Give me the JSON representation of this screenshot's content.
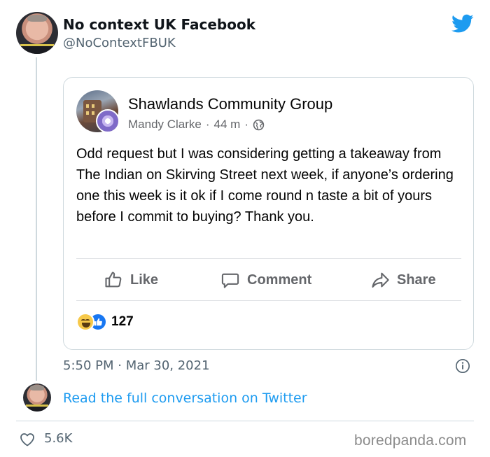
{
  "tweet": {
    "author_name": "No context UK Facebook",
    "author_handle": "@NoContextFBUK",
    "timestamp": "5:50 PM · Mar 30, 2021",
    "read_link": "Read the full conversation on Twitter",
    "like_count": "5.6K",
    "icon": "twitter-bird-icon",
    "accent_color": "#1d9bf0"
  },
  "fb_post": {
    "group_name": "Shawlands Community Group",
    "poster": "Mandy Clarke",
    "time_ago": "44 m",
    "separator": "·",
    "privacy_icon": "globe-icon",
    "text": "Odd request but I was considering getting a takeaway from The Indian on Skirving Street next week, if anyone’s ordering one this week is it ok if I come round n taste a bit of yours before I commit to buying? Thank you.",
    "actions": {
      "like": "Like",
      "comment": "Comment",
      "share": "Share"
    },
    "reaction_count": "127",
    "reaction_icons": [
      "haha-icon",
      "like-icon"
    ]
  },
  "watermark": "boredpanda.com"
}
